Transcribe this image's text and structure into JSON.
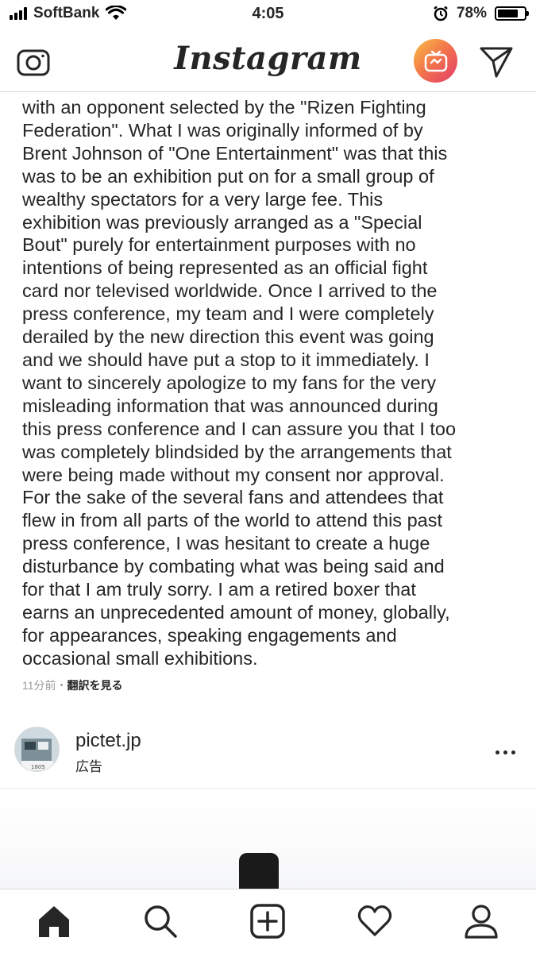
{
  "status_bar": {
    "carrier": "SoftBank",
    "time": "4:05",
    "battery_percent_label": "78%",
    "battery_level": 0.78,
    "icons": [
      "signal-icon",
      "wifi-icon",
      "alarm-icon",
      "battery-icon"
    ]
  },
  "header": {
    "logo_text": "Instagram",
    "icons": [
      "camera-icon",
      "igtv-icon",
      "direct-send-icon"
    ]
  },
  "caption": {
    "lines": [
      "with an opponent selected by the \"Rizen Fighting",
      "Federation\". What I was originally informed of by",
      "Brent Johnson of \"One Entertainment\" was that this",
      "was to be an exhibition put on for a small group of",
      "wealthy spectators for a very large fee. This",
      "exhibition was previously arranged as a \"Special",
      "Bout\" purely for entertainment purposes with no",
      "intentions of being represented as an official fight",
      "card nor televised worldwide. Once I arrived to the",
      "press conference, my team and I were completely",
      "derailed by the new direction this event was going",
      "and we should have put a stop to it immediately. I",
      "want to sincerely apologize to my fans for the very",
      "misleading information that was announced during",
      "this press conference and I can assure you that I too",
      "was completely blindsided by the arrangements that",
      "were being made without my consent nor approval.",
      "For the sake of the several fans and attendees that",
      "flew in from all parts of the world to attend this past",
      "press conference, I was hesitant to create a huge",
      "disturbance by combating what was being said and",
      "for that I am truly sorry. I am a retired boxer that",
      "earns an unprecedented amount of money, globally,",
      "for appearances, speaking engagements and",
      "occasional small exhibitions."
    ]
  },
  "meta": {
    "time_ago": "11分前",
    "separator": "・",
    "translate_label": "翻訳を見る"
  },
  "ad_post": {
    "username": "pictet.jp",
    "sponsored_label": "広告",
    "avatar_text": "1805"
  },
  "bottom_nav": {
    "items": [
      "home-icon",
      "search-icon",
      "new-post-icon",
      "activity-heart-icon",
      "profile-icon"
    ]
  },
  "colors": {
    "text": "#262626",
    "muted": "#999999",
    "divider": "#dbdbdb",
    "igtv_gradient": [
      "#f7c045",
      "#f4784a",
      "#e23a6a"
    ]
  }
}
